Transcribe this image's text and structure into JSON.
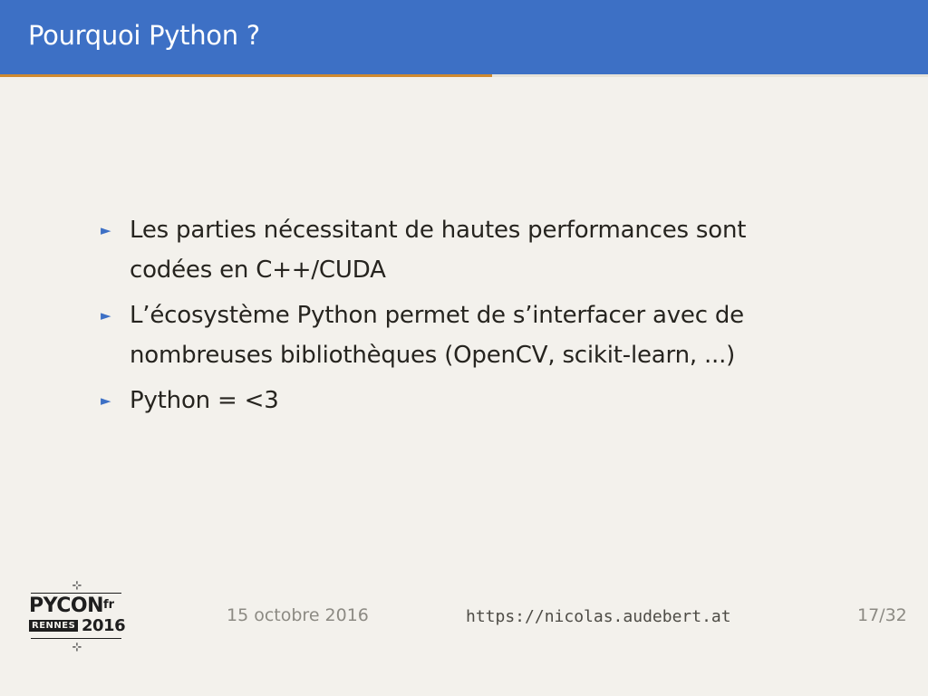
{
  "slide": {
    "title": "Pourquoi Python ?",
    "progress": 0.53
  },
  "bullets": [
    {
      "line1": "Les parties nécessitant de hautes performances sont",
      "line2": "codées en C++/CUDA"
    },
    {
      "line1": "L’écosystème Python permet de s’interfacer avec de",
      "line2": "nombreuses bibliothèques (OpenCV, scikit-learn, ...)"
    },
    {
      "line1": "Python = <3",
      "line2": ""
    }
  ],
  "bullet_marker": "►",
  "footer": {
    "date": "15 octobre 2016",
    "url": "https://nicolas.audebert.at",
    "page": "17/32"
  },
  "logo": {
    "brand": "PYCON",
    "suffix": "fr",
    "city": "RENNES",
    "year": "2016",
    "ornament": "⊹"
  },
  "colors": {
    "accent": "#3d70c5",
    "progress": "#d08a30",
    "background": "#f3f1ec"
  }
}
